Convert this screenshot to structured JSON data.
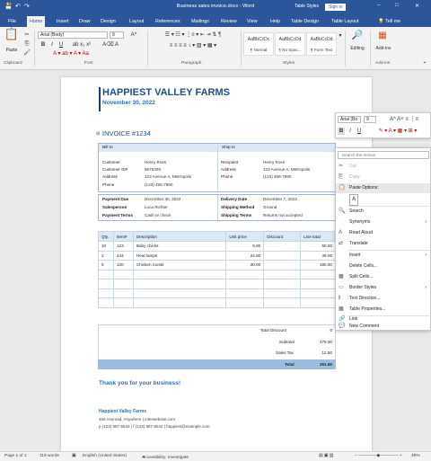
{
  "titlebar": {
    "title": "Business sales invoice.docx - Word",
    "search": "Table Styles",
    "signin": "Sign in",
    "save_icon": "💾",
    "undo": "↶",
    "redo": "↷"
  },
  "tabs": [
    "File",
    "Home",
    "Insert",
    "Draw",
    "Design",
    "Layout",
    "References",
    "Mailings",
    "Review",
    "View",
    "Help",
    "Table Design",
    "Table Layout"
  ],
  "tellme": "Tell me",
  "ribbon": {
    "font_name": "Arial (Body)",
    "font_size": "9",
    "groups": [
      "Clipboard",
      "Font",
      "Paragraph",
      "Styles",
      "Add-ins"
    ],
    "paste": "Paste",
    "styles": [
      {
        "sample": "AaBbCcDc",
        "name": "¶ Normal"
      },
      {
        "sample": "AaBbCcDd",
        "name": "¶ No Spac..."
      },
      {
        "sample": "AaBbCcDd",
        "name": "¶ Form Text"
      }
    ],
    "editing": "Editing",
    "addins": "Add-ins"
  },
  "document": {
    "company": "HAPPIEST VALLEY FARMS",
    "date": "November 30, 2022",
    "invoice_no": "INVOICE #1234",
    "bill_to": "Bill to",
    "ship_to": "Ship to",
    "bill": [
      [
        "Customer",
        "Henry Ross"
      ],
      [
        "Customer ID#",
        "8675309"
      ],
      [
        "Address",
        "123 Avenue A, Metropolis"
      ],
      [
        "Phone",
        "(123) 456-7890"
      ]
    ],
    "ship": [
      [
        "Recipient",
        "Henry Ross"
      ],
      [
        "Address",
        "123 Avenue A, Metropolis"
      ],
      [
        "Phone",
        "(123) 456-7890"
      ]
    ],
    "payment": [
      [
        "Payment Due",
        "December 30, 2022"
      ],
      [
        "Salesperson",
        "Luca Richter"
      ],
      [
        "Payment Terms",
        "Cash or check"
      ]
    ],
    "delivery": [
      [
        "Delivery Date",
        "December 7, 2022"
      ],
      [
        "Shipping Method",
        "Ground"
      ],
      [
        "Shipping Terms",
        "Returns not accepted"
      ]
    ],
    "item_headers": [
      "Qty.",
      "Item#",
      "Description",
      "Unit price",
      "Discount",
      "Line total"
    ],
    "items": [
      [
        "10",
        "123",
        "Baby chicks",
        "5.00",
        "",
        "50.00"
      ],
      [
        "2",
        "444",
        "Heat lamps",
        "24.50",
        "",
        "49.00"
      ],
      [
        "6",
        "120",
        "Chicken roosts",
        "30.00",
        "",
        "180.00"
      ],
      [
        "",
        "",
        "",
        "",
        "",
        ""
      ],
      [
        "",
        "",
        "",
        "",
        "",
        ""
      ],
      [
        "",
        "",
        "",
        "",
        "",
        ""
      ],
      [
        "",
        "",
        "",
        "",
        "",
        ""
      ]
    ],
    "totals": [
      [
        "Total Discount",
        "0"
      ],
      [
        "Subtotal",
        "279.00"
      ],
      [
        "Sales Tax",
        "12.50"
      ],
      [
        "Total",
        "291.50"
      ]
    ],
    "thanks": "Thank you for your business!",
    "footer_name": "Happiest Valley Farms",
    "footer_addr": "456 Anyroad, Anywhere | interwebsite.com",
    "footer_phone": "p (123) 987-6543 | f (123) 987-6542 | happiest@example.com"
  },
  "minitoolbar": {
    "font": "Arial (Bo",
    "size": "9"
  },
  "context_menu": {
    "search_placeholder": "Search the menus",
    "items": [
      {
        "label": "Cut",
        "icon": "✂",
        "disabled": true
      },
      {
        "label": "Copy",
        "icon": "⎘",
        "disabled": true
      },
      {
        "label": "Paste Options:",
        "icon": "📋",
        "disabled": false,
        "section": true
      },
      {
        "label": "",
        "icon": "A",
        "disabled": false
      },
      {
        "label": "Search",
        "icon": "🔍",
        "disabled": false
      },
      {
        "label": "Synonyms",
        "icon": "",
        "disabled": false,
        "sub": true
      },
      {
        "label": "Read Aloud",
        "icon": "A",
        "disabled": false
      },
      {
        "label": "Translate",
        "icon": "⇄",
        "disabled": false
      },
      {
        "label": "Insert",
        "icon": "",
        "disabled": false,
        "sub": true
      },
      {
        "label": "Delete Cells...",
        "icon": "",
        "disabled": false
      },
      {
        "label": "Split Cells...",
        "icon": "▦",
        "disabled": false
      },
      {
        "label": "Border Styles",
        "icon": "▭",
        "disabled": false,
        "sub": true
      },
      {
        "label": "Text Direction...",
        "icon": "‖",
        "disabled": false
      },
      {
        "label": "Table Properties...",
        "icon": "▦",
        "disabled": false
      },
      {
        "label": "Link",
        "icon": "🔗",
        "disabled": false
      },
      {
        "label": "New Comment",
        "icon": "💬",
        "disabled": false
      }
    ]
  },
  "status": {
    "page": "Page 1 of 1",
    "words": "119 words",
    "lang": "English (United States)",
    "access": "Accessibility: Investigate",
    "zoom": "48%"
  }
}
